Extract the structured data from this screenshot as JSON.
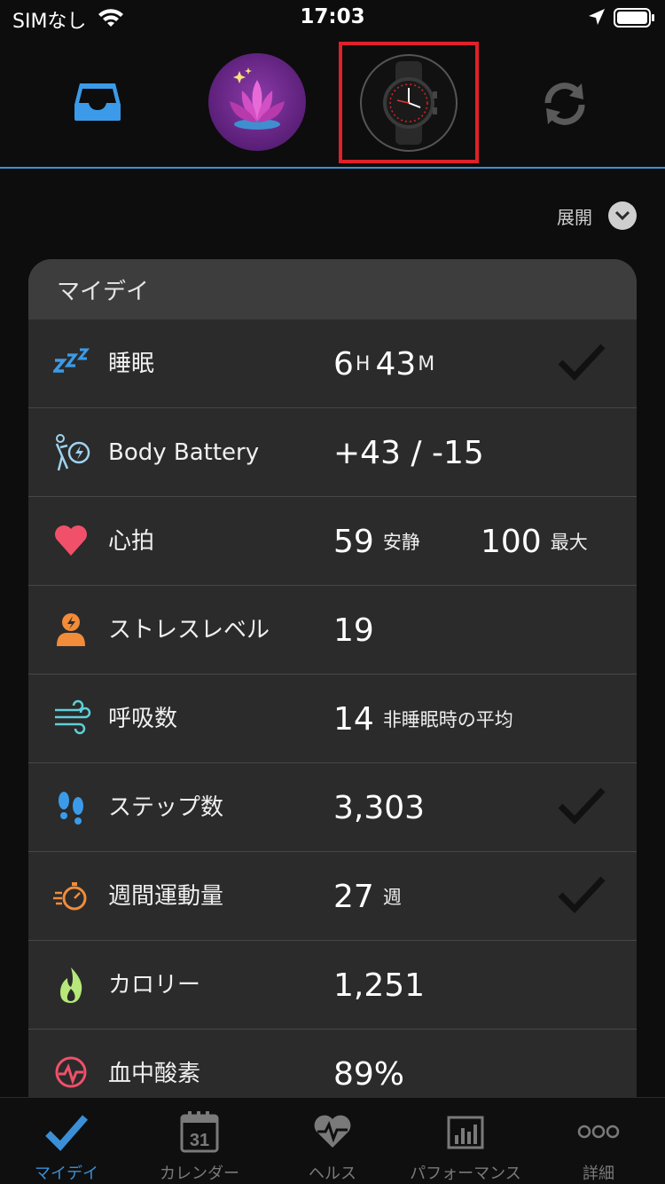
{
  "status_bar": {
    "carrier": "SIMなし",
    "time": "17:03"
  },
  "toolbar": {
    "items": [
      "inbox-icon",
      "lotus-icon",
      "watch-icon",
      "sync-icon"
    ],
    "selected": "watch-icon"
  },
  "expand": {
    "label": "展開"
  },
  "card": {
    "title": "マイデイ",
    "rows": [
      {
        "icon": "sleep-icon",
        "label": "睡眠",
        "value": "6",
        "unit_h": "H",
        "value_b": "43",
        "unit_m": "M",
        "checked": true
      },
      {
        "icon": "body-battery-icon",
        "label": "Body Battery",
        "value": "+43 / -15"
      },
      {
        "icon": "heart-icon",
        "label": "心拍",
        "value": "59",
        "value_note": "安静",
        "value2": "100",
        "value2_note": "最大"
      },
      {
        "icon": "stress-icon",
        "label": "ストレスレベル",
        "value": "19"
      },
      {
        "icon": "respiration-icon",
        "label": "呼吸数",
        "value": "14",
        "value_note": "非睡眠時の平均"
      },
      {
        "icon": "steps-icon",
        "label": "ステップ数",
        "value": "3,303",
        "checked": true
      },
      {
        "icon": "intensity-icon",
        "label": "週間運動量",
        "value": "27",
        "value_note": "週",
        "checked": true
      },
      {
        "icon": "calories-icon",
        "label": "カロリー",
        "value": "1,251"
      },
      {
        "icon": "pulse-ox-icon",
        "label": "血中酸素",
        "value": "89%"
      }
    ]
  },
  "bottom_nav": {
    "items": [
      {
        "label": "マイデイ",
        "active": true
      },
      {
        "label": "カレンダー",
        "calendar_day": "31"
      },
      {
        "label": "ヘルス"
      },
      {
        "label": "パフォーマンス"
      },
      {
        "label": "詳細"
      }
    ]
  },
  "colors": {
    "accent": "#3b8fd6",
    "highlight_box": "#e0202a",
    "card_bg": "#2b2b2b",
    "background": "#0d0d0d"
  }
}
